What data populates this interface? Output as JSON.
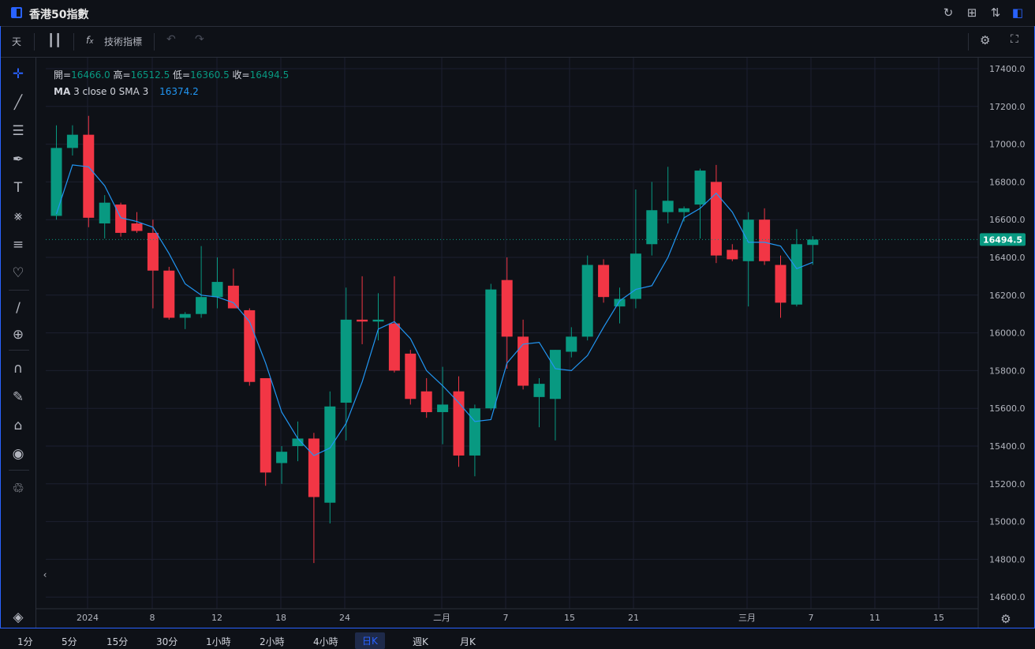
{
  "window": {
    "title": "香港50指數"
  },
  "toolbar": {
    "interval": "天",
    "indicators": "技術指標"
  },
  "legend": {
    "open_label": "開=",
    "open": "16466.0",
    "high_label": "高=",
    "high": "16512.5",
    "low_label": "低=",
    "low": "16360.5",
    "close_label": "收=",
    "close": "16494.5"
  },
  "ma": {
    "label": "MA",
    "params": "3 close 0 SMA 3",
    "value": "16374.2"
  },
  "price_tag": "16494.5",
  "timeframes": [
    "1分",
    "5分",
    "15分",
    "30分",
    "1小時",
    "2小時",
    "4小時",
    "日K",
    "週K",
    "月K"
  ],
  "active_timeframe": "日K",
  "colors": {
    "up": "#089981",
    "down": "#f23645",
    "ma": "#2196f3",
    "bg": "#0e1117",
    "grid": "#1c2030",
    "accent": "#2962ff"
  },
  "chart_data": {
    "type": "candlestick",
    "y_ticks": [
      "17400.0",
      "17200.0",
      "17000.0",
      "16800.0",
      "16600.0",
      "16400.0",
      "16200.0",
      "16000.0",
      "15800.0",
      "15600.0",
      "15400.0",
      "15200.0",
      "15000.0",
      "14800.0",
      "14600.0"
    ],
    "ylim": [
      14550,
      17470
    ],
    "x_ticks": [
      "2024",
      "8",
      "12",
      "18",
      "24",
      "二月",
      "7",
      "15",
      "21",
      "三月",
      "7",
      "11",
      "15"
    ],
    "candles": [
      {
        "o": 16620,
        "h": 17100,
        "l": 16600,
        "c": 16980
      },
      {
        "o": 16980,
        "h": 17100,
        "l": 16940,
        "c": 17050
      },
      {
        "o": 17050,
        "h": 17150,
        "l": 16560,
        "c": 16610
      },
      {
        "o": 16580,
        "h": 16730,
        "l": 16500,
        "c": 16690
      },
      {
        "o": 16680,
        "h": 16690,
        "l": 16510,
        "c": 16530
      },
      {
        "o": 16580,
        "h": 16640,
        "l": 16530,
        "c": 16540
      },
      {
        "o": 16530,
        "h": 16600,
        "l": 16130,
        "c": 16330
      },
      {
        "o": 16330,
        "h": 16350,
        "l": 16070,
        "c": 16080
      },
      {
        "o": 16080,
        "h": 16110,
        "l": 16020,
        "c": 16100
      },
      {
        "o": 16100,
        "h": 16460,
        "l": 16080,
        "c": 16190
      },
      {
        "o": 16190,
        "h": 16400,
        "l": 16130,
        "c": 16270
      },
      {
        "o": 16250,
        "h": 16340,
        "l": 16130,
        "c": 16130
      },
      {
        "o": 16120,
        "h": 16130,
        "l": 15720,
        "c": 15740
      },
      {
        "o": 15760,
        "h": 15760,
        "l": 15190,
        "c": 15260
      },
      {
        "o": 15310,
        "h": 15400,
        "l": 15200,
        "c": 15370
      },
      {
        "o": 15400,
        "h": 15530,
        "l": 15320,
        "c": 15440
      },
      {
        "o": 15440,
        "h": 15470,
        "l": 14780,
        "c": 15130
      },
      {
        "o": 15100,
        "h": 15690,
        "l": 14990,
        "c": 15610
      },
      {
        "o": 15630,
        "h": 16240,
        "l": 15430,
        "c": 16070
      },
      {
        "o": 16070,
        "h": 16300,
        "l": 15940,
        "c": 16060
      },
      {
        "o": 16060,
        "h": 16210,
        "l": 15960,
        "c": 16070
      },
      {
        "o": 16050,
        "h": 16300,
        "l": 15790,
        "c": 15800
      },
      {
        "o": 15890,
        "h": 15910,
        "l": 15620,
        "c": 15650
      },
      {
        "o": 15690,
        "h": 15760,
        "l": 15550,
        "c": 15580
      },
      {
        "o": 15580,
        "h": 15820,
        "l": 15410,
        "c": 15620
      },
      {
        "o": 15690,
        "h": 15770,
        "l": 15290,
        "c": 15350
      },
      {
        "o": 15350,
        "h": 15620,
        "l": 15240,
        "c": 15600
      },
      {
        "o": 15600,
        "h": 16260,
        "l": 15590,
        "c": 16230
      },
      {
        "o": 16280,
        "h": 16400,
        "l": 15810,
        "c": 15980
      },
      {
        "o": 15980,
        "h": 16070,
        "l": 15700,
        "c": 15720
      },
      {
        "o": 15660,
        "h": 15760,
        "l": 15500,
        "c": 15730
      },
      {
        "o": 15650,
        "h": 15910,
        "l": 15430,
        "c": 15910
      },
      {
        "o": 15900,
        "h": 16030,
        "l": 15870,
        "c": 15980
      },
      {
        "o": 15980,
        "h": 16410,
        "l": 15960,
        "c": 16360
      },
      {
        "o": 16360,
        "h": 16390,
        "l": 16160,
        "c": 16190
      },
      {
        "o": 16140,
        "h": 16240,
        "l": 16050,
        "c": 16180
      },
      {
        "o": 16180,
        "h": 16760,
        "l": 16130,
        "c": 16420
      },
      {
        "o": 16470,
        "h": 16800,
        "l": 16410,
        "c": 16650
      },
      {
        "o": 16640,
        "h": 16880,
        "l": 16580,
        "c": 16700
      },
      {
        "o": 16640,
        "h": 16670,
        "l": 16590,
        "c": 16660
      },
      {
        "o": 16680,
        "h": 16870,
        "l": 16500,
        "c": 16860
      },
      {
        "o": 16800,
        "h": 16890,
        "l": 16370,
        "c": 16410
      },
      {
        "o": 16440,
        "h": 16470,
        "l": 16380,
        "c": 16390
      },
      {
        "o": 16380,
        "h": 16640,
        "l": 16140,
        "c": 16600
      },
      {
        "o": 16600,
        "h": 16660,
        "l": 16360,
        "c": 16380
      },
      {
        "o": 16360,
        "h": 16410,
        "l": 16080,
        "c": 16160
      },
      {
        "o": 16150,
        "h": 16550,
        "l": 16140,
        "c": 16470
      },
      {
        "o": 16466,
        "h": 16512.5,
        "l": 16360.5,
        "c": 16494.5
      }
    ],
    "ma_line": [
      16630,
      16890,
      16880,
      16780,
      16610,
      16590,
      16560,
      16420,
      16260,
      16200,
      16190,
      16160,
      16060,
      15840,
      15580,
      15440,
      15350,
      15390,
      15520,
      15740,
      16020,
      16060,
      15970,
      15800,
      15720,
      15630,
      15530,
      15540,
      15840,
      15940,
      15950,
      15810,
      15800,
      15880,
      16030,
      16170,
      16230,
      16250,
      16400,
      16610,
      16660,
      16740,
      16640,
      16480,
      16480,
      16460,
      16340,
      16374.2
    ]
  }
}
